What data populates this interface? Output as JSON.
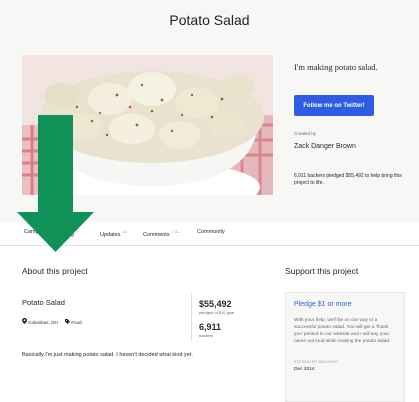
{
  "project": {
    "title": "Potato Salad"
  },
  "hero": {
    "image_alt": "potato-salad-photo"
  },
  "sidebar": {
    "making_line": "I'm making potato salad.",
    "twitter_button": "Follow me on Twitter!",
    "created_by_label": "Created by",
    "creator_name": "Zack Danger Brown",
    "summary": "6,911 backers pledged $55,492 to help bring this project to life."
  },
  "tabs": [
    {
      "label": "Campaign",
      "count": ""
    },
    {
      "label": "FAQ",
      "count": "7"
    },
    {
      "label": "Updates",
      "count": "10"
    },
    {
      "label": "Comments",
      "count": "7,3—"
    },
    {
      "label": "Community",
      "count": ""
    }
  ],
  "about": {
    "heading": "About this project",
    "card_title": "Potato Salad",
    "location": "Columbus, OH",
    "category": "Food",
    "pledged": "$55,492",
    "pledged_sub": "pledged of $10 goal",
    "backers": "6,911",
    "backers_sub": "backers",
    "description": "Basically I'm just making potato salad. I haven't decided what kind yet."
  },
  "support": {
    "heading": "Support this project",
    "pledge_title": "Pledge $1 or more",
    "pledge_text": "With your help, we'll be on our way to a successful potato salad. You will get a 'thank you' posted to our website and I will say your name out loud while making the potato salad.",
    "est_label": "ESTIMATED DELIVERY",
    "est_value": "Dec 2014"
  },
  "colors": {
    "accent_blue": "#2f5ce5",
    "arrow_green": "#0f9157",
    "count_green": "#4fc283"
  },
  "icons": {
    "location": "map-pin-icon",
    "category": "tag-icon",
    "arrow": "down-arrow-icon"
  }
}
